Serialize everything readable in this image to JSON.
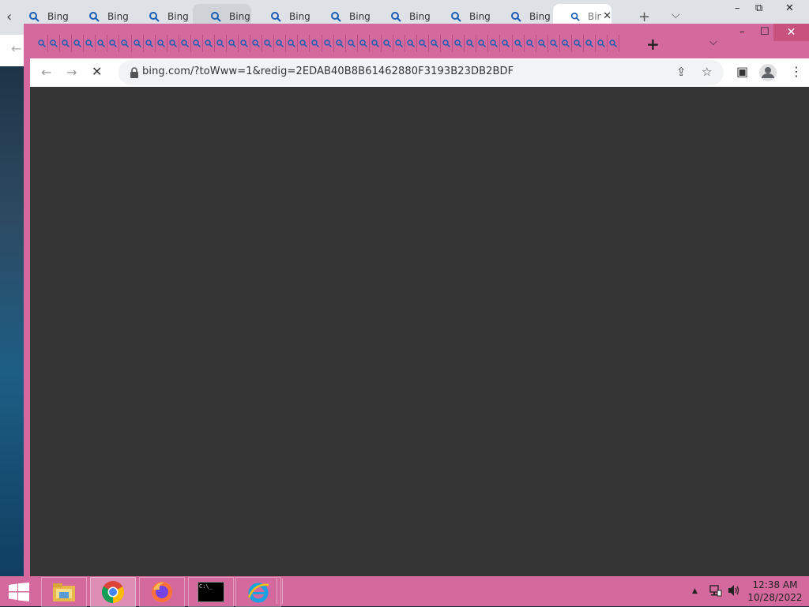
{
  "back_window": {
    "tabs": [
      {
        "title": "Bing",
        "state": "normal"
      },
      {
        "title": "Bing",
        "state": "normal"
      },
      {
        "title": "Bing",
        "state": "normal"
      },
      {
        "title": "Bing",
        "state": "hover"
      },
      {
        "title": "Bing",
        "state": "normal"
      },
      {
        "title": "Bing",
        "state": "normal"
      },
      {
        "title": "Bing",
        "state": "normal"
      },
      {
        "title": "Bing",
        "state": "normal"
      },
      {
        "title": "Bing",
        "state": "normal"
      },
      {
        "title": "Bin",
        "state": "active"
      }
    ],
    "new_tab_glyph": "+",
    "tab_search_glyph": "⌵",
    "minimize_glyph": "–",
    "restore_glyph": "⧉",
    "close_glyph": "✕"
  },
  "front_window": {
    "mini_tab_count": 49,
    "new_tab_glyph": "+",
    "tab_search_glyph": "⌵",
    "minimize_glyph": "–",
    "maximize_glyph": "☐",
    "close_glyph": "✕",
    "toolbar": {
      "back_glyph": "←",
      "forward_glyph": "→",
      "stop_glyph": "✕",
      "url": "bing.com/?toWww=1&redig=2EDAB40B8B61462880F3193B23DB2BDF",
      "share_glyph": "⇪",
      "bookmark_glyph": "☆",
      "sidepanel_glyph": "▣",
      "menu_glyph": "⋮"
    },
    "content_color": "#353535"
  },
  "taskbar": {
    "apps": [
      "file-explorer",
      "chrome",
      "firefox",
      "command-prompt",
      "internet-explorer"
    ],
    "cmd_text": "C:\\_",
    "tray_up_glyph": "▲",
    "time": "12:38 AM",
    "date": "10/28/2022"
  },
  "colors": {
    "accent_pink": "#d3699d",
    "content_dark": "#353535",
    "tab_icon_blue": "#1a5fb4"
  }
}
